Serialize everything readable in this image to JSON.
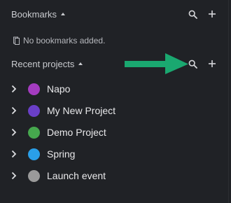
{
  "bookmarks": {
    "title": "Bookmarks",
    "empty_text": "No bookmarks added."
  },
  "recent_projects": {
    "title": "Recent projects",
    "items": [
      {
        "label": "Napo",
        "color": "#a43cc0"
      },
      {
        "label": "My New Project",
        "color": "#6a3fc8"
      },
      {
        "label": "Demo Project",
        "color": "#46a84e"
      },
      {
        "label": "Spring",
        "color": "#2a9fe8"
      },
      {
        "label": "Launch event",
        "color": "#9a9a9a"
      }
    ]
  },
  "icons": {
    "search": "search-icon",
    "add": "plus-icon",
    "collapse": "caret-up-icon",
    "expand": "chevron-right-icon",
    "bookmark": "bookmark-icon"
  },
  "colors": {
    "background": "#202226",
    "annotation_arrow": "#1aa870"
  }
}
